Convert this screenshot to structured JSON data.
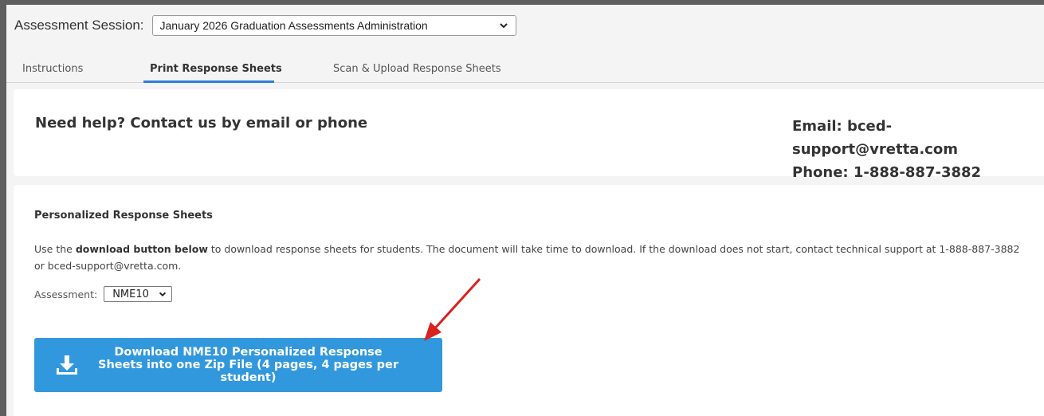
{
  "session": {
    "label": "Assessment Session:",
    "selected": "January 2026 Graduation Assessments Administration"
  },
  "tabs": [
    {
      "label": "Instructions",
      "active": false
    },
    {
      "label": "Print Response Sheets",
      "active": true
    },
    {
      "label": "Scan & Upload Response Sheets",
      "active": false
    }
  ],
  "help": {
    "title": "Need help? Contact us by email or phone",
    "email": "Email: bced-support@vretta.com",
    "phone": "Phone: 1-888-887-3882"
  },
  "sheets": {
    "title": "Personalized Response Sheets",
    "desc_prefix": "Use the ",
    "desc_bold": "download button below",
    "desc_suffix": " to download response sheets for students. The document will take time to download. If the download does not start, contact technical support at 1-888-887-3882 or bced-support@vretta.com.",
    "assessment_label": "Assessment:",
    "assessment_selected": "NME10",
    "download_line1": "Download NME10 Personalized Response",
    "download_line2": "Sheets into one Zip File (4 pages, 4 pages per student)"
  },
  "icons": {
    "download": "download-tray-icon",
    "chevron": "chevron-down-icon",
    "annotation": "red-arrow-annotation"
  },
  "colors": {
    "accent": "#2b7fd4",
    "button": "#3298dd",
    "annotation": "#d9231f"
  }
}
